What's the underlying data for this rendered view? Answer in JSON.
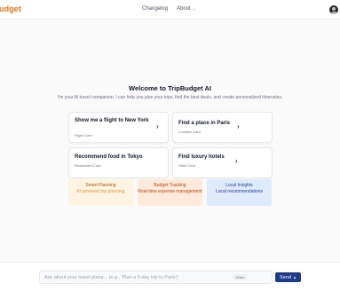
{
  "header": {
    "brand": "udget",
    "nav": [
      {
        "label": "Changelog"
      },
      {
        "label": "About"
      }
    ],
    "avatar_icon": "user-avatar"
  },
  "welcome": {
    "title": "Welcome to TripBudget AI",
    "subtitle": "I'm your AI travel companion. I can help you plan your trips, find the best deals, and create personalized itineraries."
  },
  "cards": [
    {
      "title": "Show me a flight to New York",
      "subtitle": "Flight Card"
    },
    {
      "title": "Find a place in Paris",
      "subtitle": "Location Card"
    },
    {
      "title": "Recommend food in Tokyo",
      "subtitle": "Restaurant Card"
    },
    {
      "title": "Find luxury hotels",
      "subtitle": "Hotel Card"
    }
  ],
  "features": [
    {
      "title": "Smart Planning",
      "desc": "AI-powered trip planning"
    },
    {
      "title": "Budget Tracking",
      "desc": "Real-time expense management"
    },
    {
      "title": "Local Insights",
      "desc": "Local recommendations"
    }
  ],
  "composer": {
    "placeholder": "Ask about your travel plans... (e.g., 'Plan a 5-day trip to Paris')",
    "value": "",
    "counter": "0/3ex",
    "send_label": "Send",
    "send_icon": "arrow-up"
  },
  "colors": {
    "brand": "#f97316",
    "send": "#1e3a8a",
    "tile_planning": "#fdf5e2",
    "tile_budget": "#ffeadb",
    "tile_insights": "#dfeafb"
  }
}
